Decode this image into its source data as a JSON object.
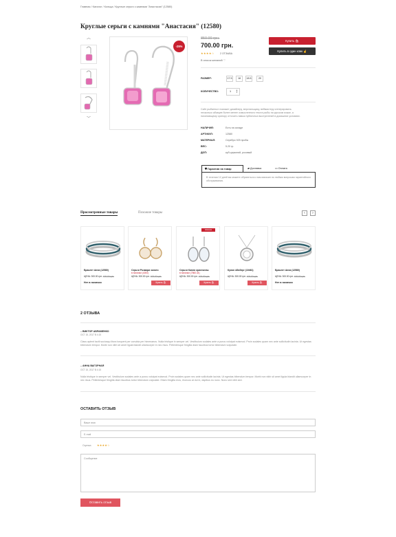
{
  "breadcrumb": "Главная / Каталог / Кольца / Круглые серьги с камнями \"Анастасия\" (12580)",
  "product": {
    "title": "Круглые серьги с камнями \"Анастасия\" (12580)",
    "old_price": "850.00 грн.",
    "price": "700.00 грн.",
    "discount": "-25%",
    "rating_stars": "★★★★☆",
    "rating_count": "2 ОТЗЫВА",
    "wishlist": "В список желаний",
    "buy_label": "Купить",
    "oneclick_label": "Купить в один клик",
    "size_label": "РАЗМЕР:",
    "sizes": [
      "17.5",
      "18",
      "18.5",
      "20"
    ],
    "qty_label": "КОЛИЧЕСТВО:",
    "qty": "1",
    "description": "Сайт рыбатекст поможет дизайнеру, верстальщику, вебмастеру сгенерировать несколько абзацев более менее осмысленного текста рыбы на русском языке, а начинающему оратору отточить навык публичных выступлений в домашних условиях.",
    "specs": [
      {
        "key": "НАЛИЧИЕ:",
        "value": "Есть на складе"
      },
      {
        "key": "АРТИКУЛ:",
        "value": "12580"
      },
      {
        "key": "МАТЕРИАЛ:",
        "value": "Серебро 925 пробы"
      },
      {
        "key": "ВЕС:",
        "value": "5.20 гр."
      },
      {
        "key": "ДОП:",
        "value": "куб.цирконий, розовый"
      }
    ],
    "tabs": [
      "Гарантия на товар",
      "Доставка",
      "Оплата"
    ],
    "tab_text": "В течении 12 дней вы можете обратиться к нам магазин по любым вопросам гарантийного обслуживания."
  },
  "viewed": {
    "tab_active": "Просмотренные товары",
    "tab_other": "Похожие товары",
    "cards": [
      {
        "name": "Браслет Анна (12580)",
        "sub": "",
        "price": "ЦЕНА: 300.00 грн.",
        "old": "400.00 грн.",
        "na": "Нет в наличии",
        "btn": "",
        "ribbon": "",
        "type": "ring"
      },
      {
        "name": "Серьги Розмари золото",
        "sub": "в наличии (4000)",
        "price": "ЦЕНА: 300.00 грн.",
        "old": "400.00 грн.",
        "na": "",
        "btn": "Купить",
        "ribbon": "",
        "type": "earring-gold"
      },
      {
        "name": "Серьги Капля кристаллы",
        "sub": "в наличии (7860.34)",
        "price": "ЦЕНА: 300.00 грн.",
        "old": "400.00 грн.",
        "na": "",
        "btn": "Купить",
        "ribbon": "Новинка",
        "type": "earring-drop"
      },
      {
        "name": "Кулон Айсберг (10461)",
        "sub": "",
        "price": "ЦЕНА: 300.00 грн.",
        "old": "400.00 грн.",
        "na": "",
        "btn": "Купить",
        "ribbon": "",
        "type": "pendant"
      },
      {
        "name": "Браслет Анна (12580)",
        "sub": "",
        "price": "ЦЕНА: 300.00 грн.",
        "old": "400.00 грн.",
        "na": "Нет в наличии",
        "btn": "",
        "ribbon": "",
        "type": "ring"
      }
    ]
  },
  "reviews": {
    "title": "2 ОТЗЫВА",
    "items": [
      {
        "author": "– ВИКТОР АБРАМЕНКО",
        "date": "ОСТ 15, 2017 В 4:15",
        "text": "Class aptent taciti sociosqu litora torquent per conubia per himenaeos. Nulla tristique in semper vel. Vestibulum sodales ante a purus volutpat euismod. Proin sodales quam nec ante sollicitudin lacinia. Ut egestas bibendum tempor. Morbi non nibh sit amet ligula blandit ullamcorper in nec risus. Pellentesque fringilla diam faucibus tortor bibendum vulputate."
      },
      {
        "author": "– АННА ВАГОРНАЯ",
        "date": "ОСТ 15, 2017 В 4:15",
        "text": "Nulla tristique in semper vel. Vestibulum sodales ante a purus volutpat euismod. Proin sodales quam nec ante sollicitudin lacinia. Ut egestas bibendum tempor. Morbi non nibh sit amet ligula blandit ullamcorper in nec risus. Pellentesque fringilla diam faucibus tortor bibendum vulputate. Etiam fringilla eros, rhoncus at dui in, dapibus eu nunc. Nunc sed nibh sed."
      }
    ]
  },
  "form": {
    "title": "ОСТАВИТЬ ОТЗЫВ",
    "name_placeholder": "Ваше имя",
    "email_placeholder": "E-mail",
    "rating_label": "Оценка",
    "rating_stars": "★★★★☆",
    "message_placeholder": "Сообщение",
    "submit": "Оставить отзыв"
  },
  "colors": {
    "accent": "#c8202f",
    "dark": "#333333",
    "stone": "#e26ab0"
  }
}
